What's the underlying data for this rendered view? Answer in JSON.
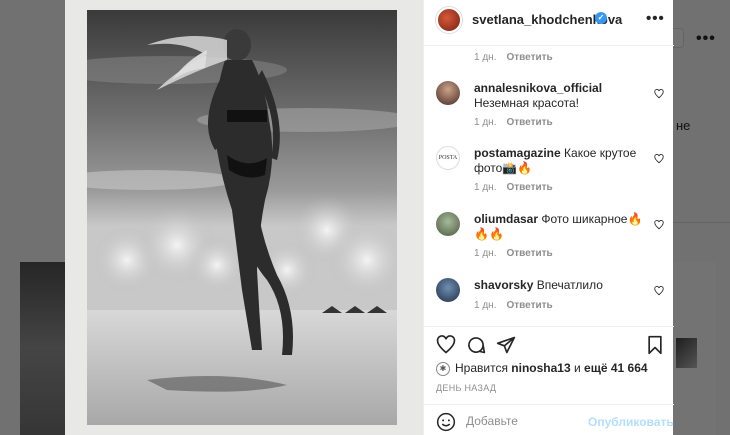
{
  "background": {
    "partial_text": "не"
  },
  "post": {
    "author": "svetlana_khodchenkova",
    "more_icon": "more-icon"
  },
  "prev_comment_meta": {
    "time": "1 дн.",
    "reply": "Ответить"
  },
  "comments": [
    {
      "user": "annalesnikova_official",
      "text": "Неземная красота!",
      "time": "1 дн.",
      "reply": "Ответить"
    },
    {
      "user": "postamagazine",
      "text": "Какое крутое фото📸🔥",
      "time": "1 дн.",
      "reply": "Ответить",
      "avatar_text": "POSTA"
    },
    {
      "user": "oliumdasar",
      "text": "Фото шикарное🔥🔥🔥",
      "time": "1 дн.",
      "reply": "Ответить"
    },
    {
      "user": "shavorsky",
      "text": "Впечатлило",
      "time": "1 дн.",
      "reply": "Ответить"
    }
  ],
  "likes": {
    "prefix": "Нравится",
    "user": "ninosha13",
    "middle": "и",
    "others": "ещё 41 664"
  },
  "time_ago": "ДЕНЬ НАЗАД",
  "add_comment": {
    "placeholder": "Добавьте",
    "publish": "Опубликовать"
  },
  "colors": {
    "accent_blue": "#3897f0",
    "publish_disabled": "#b2dffc"
  }
}
